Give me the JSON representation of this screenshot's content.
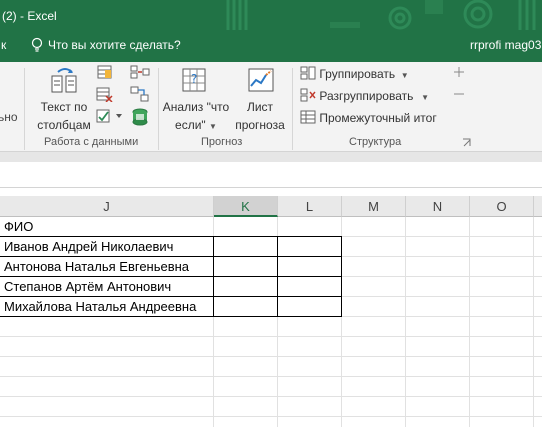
{
  "title_bar": {
    "title": "(2) - Excel",
    "tell_me_left_fragment": "к",
    "tell_me": "Что вы хотите сделать?",
    "user": "rrprofi mag03"
  },
  "ribbon": {
    "left_fragment": "ьно",
    "data_tools": {
      "text_to_columns_line1": "Текст по",
      "text_to_columns_line2": "столбцам",
      "group_label": "Работа с данными"
    },
    "forecast": {
      "what_if_line1": "Анализ \"что",
      "what_if_line2": "если\"",
      "forecast_sheet_line1": "Лист",
      "forecast_sheet_line2": "прогноза",
      "group_label": "Прогноз"
    },
    "outline": {
      "group": "Группировать",
      "ungroup": "Разгруппировать",
      "subtotal": "Промежуточный итог",
      "group_label": "Структура"
    }
  },
  "sheet": {
    "columns": [
      "J",
      "K",
      "L",
      "M",
      "N",
      "O"
    ],
    "selected_column": "K",
    "cells": {
      "header": "ФИО",
      "rows": [
        "Иванов Андрей Николаевич",
        "Антонова Наталья Евгеньевна",
        "Степанов Артём Антонович",
        "Михайлова Наталья Андреевна"
      ]
    }
  },
  "colors": {
    "excel_green": "#217346",
    "ribbon_bg": "#f3f3f3",
    "header_bg": "#e9e9e9"
  }
}
